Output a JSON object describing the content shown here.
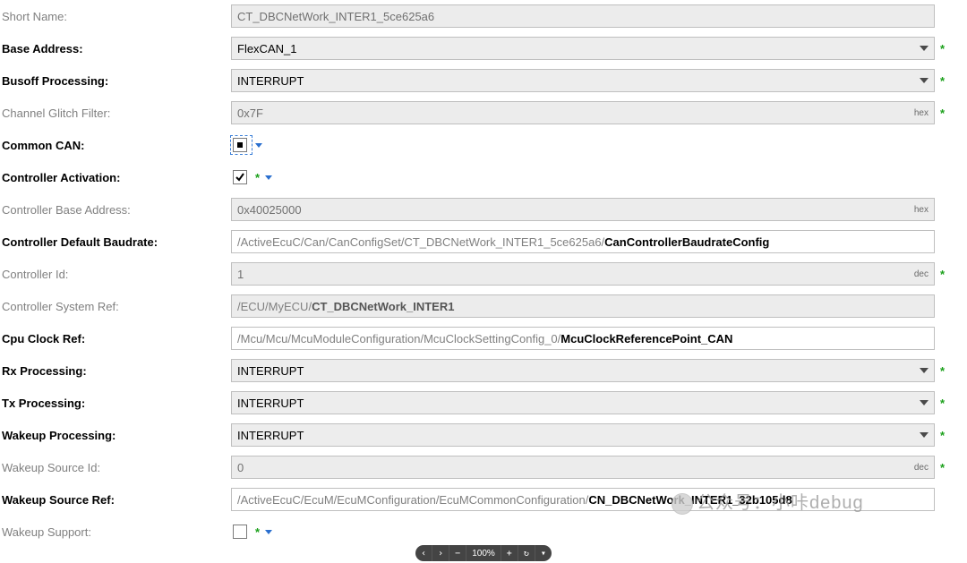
{
  "fields": {
    "short_name": {
      "label": "Short Name:",
      "value": "CT_DBCNetWork_INTER1_5ce625a6"
    },
    "base_address": {
      "label": "Base Address:",
      "value": "FlexCAN_1"
    },
    "busoff_proc": {
      "label": "Busoff Processing:",
      "value": "INTERRUPT"
    },
    "glitch": {
      "label": "Channel Glitch Filter:",
      "value": "0x7F",
      "unit": "hex"
    },
    "common_can": {
      "label": "Common CAN:"
    },
    "ctrl_activation": {
      "label": "Controller Activation:"
    },
    "ctrl_base_addr": {
      "label": "Controller Base Address:",
      "value": "0x40025000",
      "unit": "hex"
    },
    "ctrl_def_baud": {
      "label": "Controller Default Baudrate:",
      "gray": "/ActiveEcuC/Can/CanConfigSet/CT_DBCNetWork_INTER1_5ce625a6/",
      "black": "CanControllerBaudrateConfig"
    },
    "ctrl_id": {
      "label": "Controller Id:",
      "value": "1",
      "unit": "dec"
    },
    "ctrl_sys_ref": {
      "label": "Controller System Ref:",
      "gray": "/ECU/MyECU/",
      "black": "CT_DBCNetWork_INTER1"
    },
    "cpu_clock": {
      "label": "Cpu Clock Ref:",
      "gray": "/Mcu/Mcu/McuModuleConfiguration/McuClockSettingConfig_0/",
      "black": "McuClockReferencePoint_CAN"
    },
    "rx_proc": {
      "label": "Rx Processing:",
      "value": "INTERRUPT"
    },
    "tx_proc": {
      "label": "Tx Processing:",
      "value": "INTERRUPT"
    },
    "wakeup_proc": {
      "label": "Wakeup Processing:",
      "value": "INTERRUPT"
    },
    "wakeup_src_id": {
      "label": "Wakeup Source Id:",
      "value": "0",
      "unit": "dec"
    },
    "wakeup_src_ref": {
      "label": "Wakeup Source Ref:",
      "gray": "/ActiveEcuC/EcuM/EcuMConfiguration/EcuMCommonConfiguration/",
      "black": "CN_DBCNetWork_INTER1_32b105d8"
    },
    "wakeup_support": {
      "label": "Wakeup Support:"
    }
  },
  "marks": {
    "asterisk": "*"
  },
  "footer": {
    "zoom": "100%"
  },
  "watermark": {
    "text": "公众号：小咔debug"
  }
}
